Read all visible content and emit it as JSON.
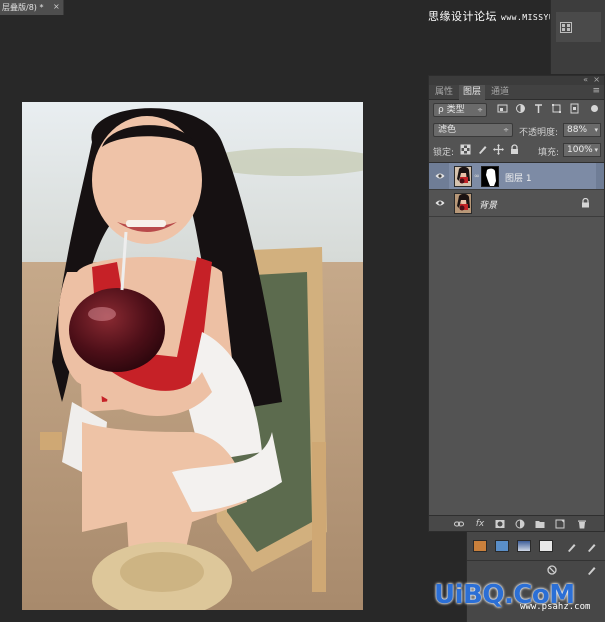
{
  "document": {
    "tab_title": "层叠版/8) *",
    "tab_close": "×"
  },
  "watermark": {
    "site_name": "思缘设计论坛",
    "site_url": "www.MISSYUAN.com",
    "uibq_logo": "UiBQ.CoM",
    "uibq_url": "www.psahz.com"
  },
  "layers_panel": {
    "collapse_glyph": "«",
    "close_glyph": "×",
    "menu_glyph": "≡",
    "tabs": [
      {
        "label": "属性",
        "active": false
      },
      {
        "label": "图层",
        "active": true
      },
      {
        "label": "通道",
        "active": false
      }
    ],
    "filter": {
      "kind_label": "ρ 类型",
      "arrow": "÷"
    },
    "blend_mode": "滤色",
    "opacity_label": "不透明度:",
    "opacity_value": "88%",
    "lock_label": "锁定:",
    "fill_label": "填充:",
    "fill_value": "100%",
    "layers": [
      {
        "name": "图层 1",
        "selected": true,
        "has_mask": true,
        "italic": false
      },
      {
        "name": "背景",
        "selected": false,
        "has_mask": false,
        "italic": true,
        "locked": true
      }
    ],
    "bottom_icons": [
      "link-icon",
      "fx-icon",
      "mask-icon",
      "adjustment-icon",
      "group-icon",
      "new-layer-icon",
      "trash-icon"
    ],
    "fx_label": "fx"
  },
  "colors": {
    "app_bg": "#282828",
    "panel_bg": "#535353",
    "selected_layer": "#7d8ba5",
    "watermark_blue": "#2b6fd6"
  }
}
